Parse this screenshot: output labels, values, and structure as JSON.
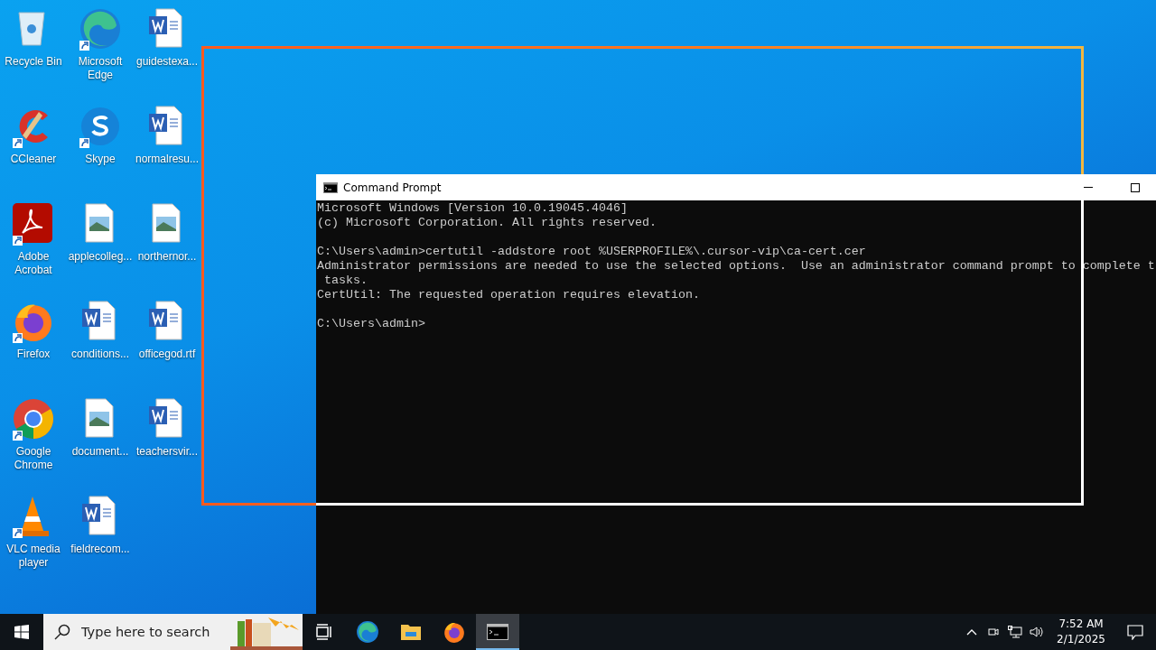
{
  "desktop_icons": [
    {
      "label": "Recycle Bin",
      "kind": "recycle",
      "shortcut": false
    },
    {
      "label": "Microsoft Edge",
      "kind": "edge",
      "shortcut": true
    },
    {
      "label": "guidestexa...",
      "kind": "word",
      "shortcut": false
    },
    {
      "label": "CCleaner",
      "kind": "ccleaner",
      "shortcut": true
    },
    {
      "label": "Skype",
      "kind": "skype",
      "shortcut": true
    },
    {
      "label": "normalresu...",
      "kind": "word",
      "shortcut": false
    },
    {
      "label": "Adobe Acrobat",
      "kind": "acrobat",
      "shortcut": true
    },
    {
      "label": "applecolleg...",
      "kind": "image",
      "shortcut": false
    },
    {
      "label": "northernor...",
      "kind": "image",
      "shortcut": false
    },
    {
      "label": "Firefox",
      "kind": "firefox",
      "shortcut": true
    },
    {
      "label": "conditions...",
      "kind": "word",
      "shortcut": false
    },
    {
      "label": "officegod.rtf",
      "kind": "word",
      "shortcut": false
    },
    {
      "label": "Google Chrome",
      "kind": "chrome",
      "shortcut": true
    },
    {
      "label": "document...",
      "kind": "image",
      "shortcut": false
    },
    {
      "label": "teachersvir...",
      "kind": "word",
      "shortcut": false
    },
    {
      "label": "VLC media player",
      "kind": "vlc",
      "shortcut": true
    },
    {
      "label": "fieldrecom...",
      "kind": "word",
      "shortcut": false
    }
  ],
  "console_window": {
    "title": "Command Prompt",
    "blocks": [
      [
        "Microsoft Windows [Version 10.0.19045.4046]",
        "(c) Microsoft Corporation. All rights reserved."
      ],
      [
        "C:\\Users\\admin>certutil -addstore root %USERPROFILE%\\.cursor-vip\\ca-cert.cer",
        "Administrator permissions are needed to use the selected options.  Use an administrator command prompt to complete t",
        " tasks.",
        "CertUtil: The requested operation requires elevation."
      ],
      [
        "C:\\Users\\admin>"
      ]
    ]
  },
  "taskbar": {
    "search": {
      "placeholder": "Type here to search"
    },
    "apps": [
      {
        "kind": "taskview",
        "selected": false
      },
      {
        "kind": "edge",
        "selected": false
      },
      {
        "kind": "explorer",
        "selected": false
      },
      {
        "kind": "firefox",
        "selected": false
      },
      {
        "kind": "console",
        "selected": true
      }
    ],
    "clock": {
      "time": "7:52 AM",
      "date": "2/1/2025"
    }
  }
}
